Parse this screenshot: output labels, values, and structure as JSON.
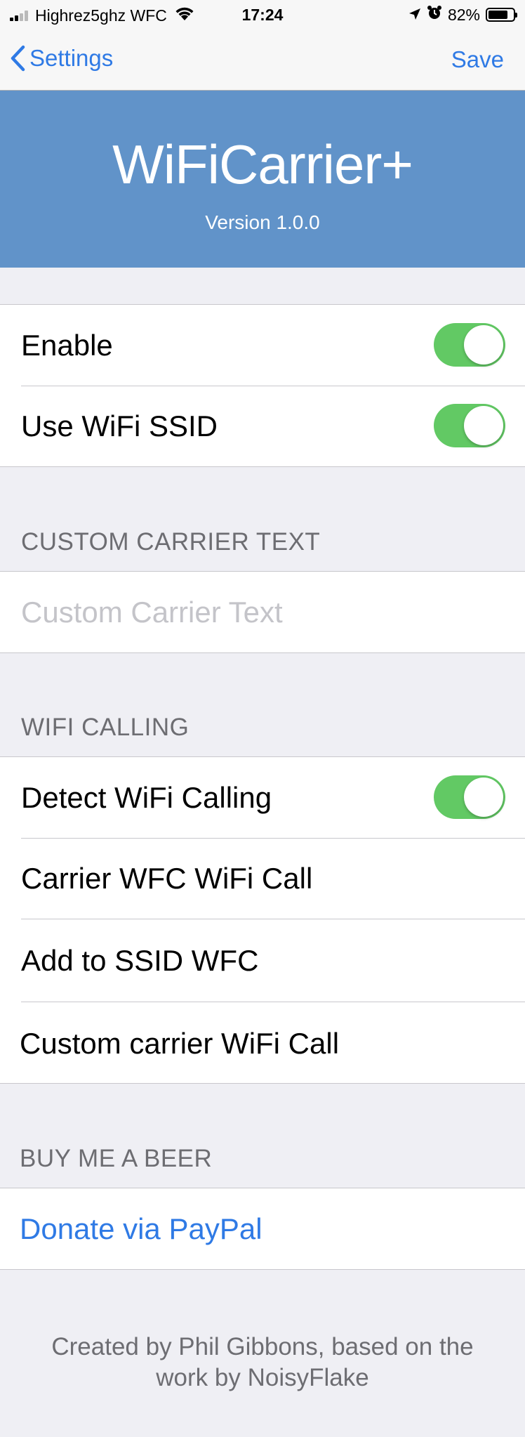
{
  "status_bar": {
    "carrier": "Highrez5ghz WFC",
    "time": "17:24",
    "battery": "82%"
  },
  "nav": {
    "back_label": "Settings",
    "save_label": "Save"
  },
  "banner": {
    "title": "WiFiCarrier+",
    "version": "Version 1.0.0"
  },
  "general": {
    "enable_label": "Enable",
    "enable_on": true,
    "use_ssid_label": "Use WiFi SSID",
    "use_ssid_on": true
  },
  "custom_carrier": {
    "header": "CUSTOM CARRIER TEXT",
    "placeholder": "Custom Carrier Text"
  },
  "wifi_calling": {
    "header": "WIFI CALLING",
    "detect_label": "Detect WiFi Calling",
    "detect_on": true,
    "items": [
      "Carrier WFC  WiFi Call",
      "Add to SSID  WFC",
      "Custom carrier  WiFi Call"
    ]
  },
  "donate": {
    "header": "BUY ME A BEER",
    "link_label": "Donate via PayPal"
  },
  "footer": {
    "text": "Created by Phil Gibbons, based on the work by NoisyFlake"
  },
  "colors": {
    "accent": "#2f7ae5",
    "banner": "#6193c9",
    "switch_on": "#62c964"
  }
}
